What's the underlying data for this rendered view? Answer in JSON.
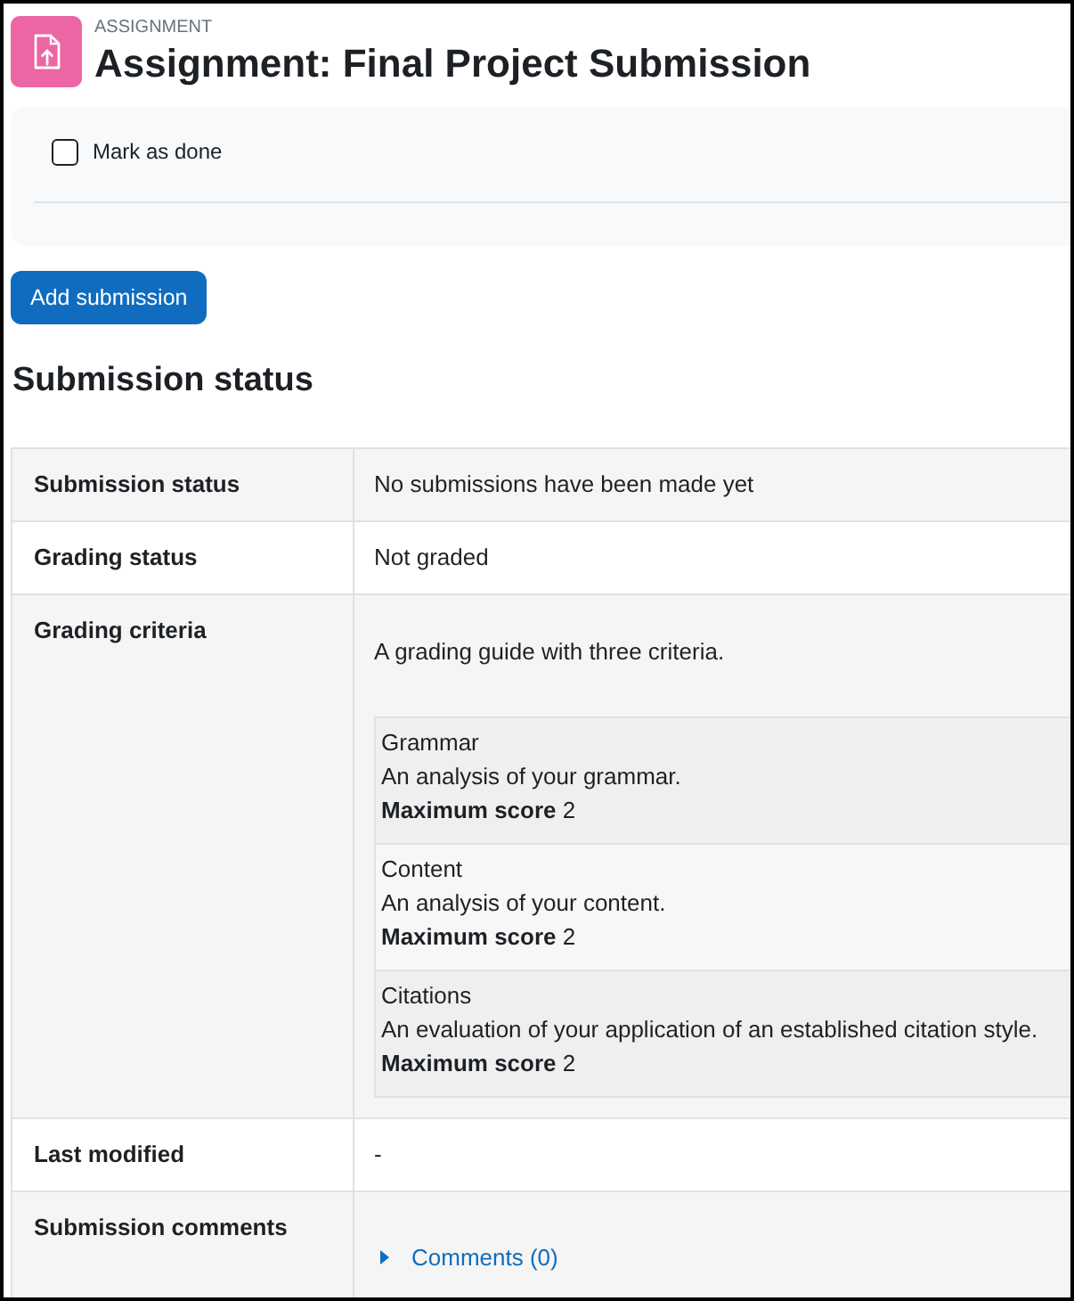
{
  "activity": {
    "type_label": "ASSIGNMENT",
    "title": "Assignment: Final Project Submission"
  },
  "completion": {
    "label": "Mark as done",
    "checked": false
  },
  "add_button": {
    "label": "Add submission"
  },
  "section_heading": "Submission status",
  "status_table": {
    "rows": [
      {
        "kind": "text",
        "label": "Submission status",
        "value": "No submissions have been made yet"
      },
      {
        "kind": "text",
        "label": "Grading status",
        "value": "Not graded"
      },
      {
        "kind": "guide",
        "label": "Grading criteria",
        "description": "A grading guide with three criteria.",
        "criteria": [
          {
            "name": "Grammar",
            "description": "An analysis of your grammar.",
            "max_score": "**Maximum score** 2"
          },
          {
            "name": "Content",
            "description": "An analysis of your content.",
            "max_score": "**Maximum score** 2"
          },
          {
            "name": "Citations",
            "description": "An evaluation of your application of an established citation style.",
            "max_score": "**Maximum score** 2"
          }
        ]
      },
      {
        "kind": "text",
        "label": "Last modified",
        "value": "-"
      },
      {
        "kind": "comments",
        "label": "Submission comments",
        "link": "Comments (0)",
        "expanded": false
      }
    ]
  }
}
